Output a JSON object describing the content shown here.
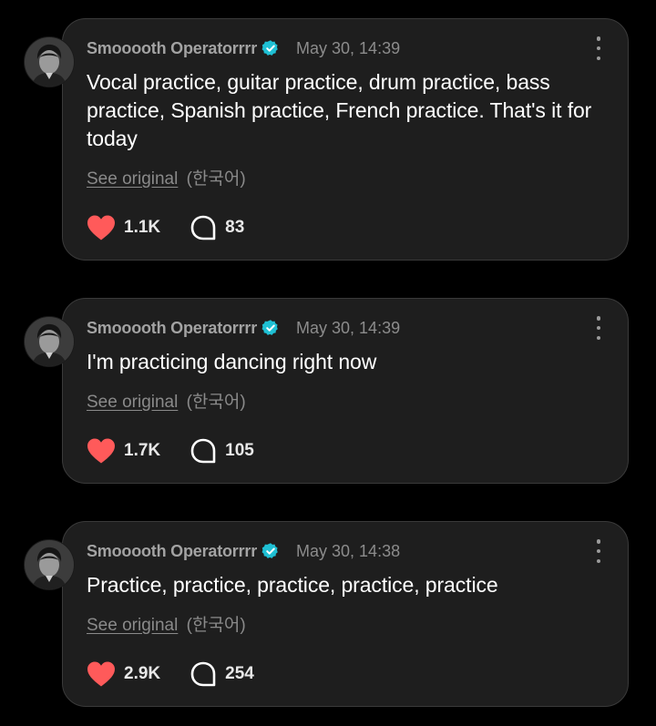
{
  "colors": {
    "background": "#000000",
    "card": "#1e1e1e",
    "heart": "#ff5a5a",
    "verified": "#1fc0d4"
  },
  "posts": [
    {
      "author": "Smooooth Operatorrrr",
      "verified_icon": "verified-badge-icon",
      "date": "May 30, 14:39",
      "text": "Vocal practice, guitar practice, drum practice, bass practice, Spanish practice, French practice. That's it for today",
      "see_original": "See original",
      "language": "(한국어)",
      "likes": "1.1K",
      "replies": "83"
    },
    {
      "author": "Smooooth Operatorrrr",
      "verified_icon": "verified-badge-icon",
      "date": "May 30, 14:39",
      "text": "I'm practicing dancing right now",
      "see_original": "See original",
      "language": "(한국어)",
      "likes": "1.7K",
      "replies": "105"
    },
    {
      "author": "Smooooth Operatorrrr",
      "verified_icon": "verified-badge-icon",
      "date": "May 30, 14:38",
      "text": "Practice, practice, practice, practice, practice",
      "see_original": "See original",
      "language": "(한국어)",
      "likes": "2.9K",
      "replies": "254"
    }
  ]
}
